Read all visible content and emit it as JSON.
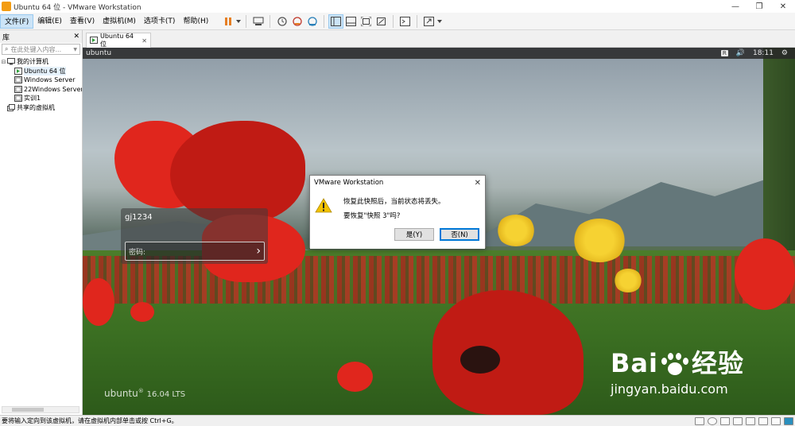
{
  "window": {
    "title": "Ubuntu 64 位 - VMware Workstation",
    "controls": {
      "minimize": "—",
      "restore": "❐",
      "close": "✕"
    }
  },
  "menubar": {
    "items": [
      "文件(F)",
      "编辑(E)",
      "查看(V)",
      "虚拟机(M)",
      "选项卡(T)",
      "帮助(H)"
    ]
  },
  "toolbar": {
    "icons": [
      "pause-icon",
      "send-ctrl-alt-del-icon",
      "snapshot-icon",
      "revert-snapshot-icon",
      "snapshot-manager-icon",
      "show-library-icon",
      "thumbnail-bar-icon",
      "fullscreen-icon",
      "unity-icon",
      "console-icon",
      "stretch-icon"
    ]
  },
  "library": {
    "title": "库",
    "close": "✕",
    "search_placeholder": "在此处键入内容...",
    "tree": [
      {
        "label": "我的计算机",
        "level": 0,
        "icon": "computer-icon",
        "expander": "⊟"
      },
      {
        "label": "Ubuntu 64 位",
        "level": 1,
        "icon": "vm-running-icon",
        "selected": true
      },
      {
        "label": "Windows Server",
        "level": 1,
        "icon": "vm-icon"
      },
      {
        "label": "22Windows Server",
        "level": 1,
        "icon": "vm-icon"
      },
      {
        "label": "实训1",
        "level": 1,
        "icon": "vm-icon"
      },
      {
        "label": "共享的虚拟机",
        "level": 0,
        "icon": "shared-vm-icon"
      }
    ]
  },
  "tabs": [
    {
      "label": "Ubuntu 64 位",
      "close": "✕"
    }
  ],
  "guest": {
    "topbar": {
      "hostname": "ubuntu",
      "keyboard": "R",
      "volume": "🔊",
      "time": "18:11",
      "settings": "⚙"
    },
    "login": {
      "username": "gj1234",
      "password_placeholder": "密码:",
      "submit_arrow": "›"
    },
    "branding": {
      "name": "ubuntu",
      "mark": "®",
      "version": "16.04 LTS"
    }
  },
  "dialog": {
    "title": "VMware Workstation",
    "close": "✕",
    "message_line1": "恢复此快照后，当前状态将丢失。",
    "message_line2": "要恢复\"快照 3\"吗?",
    "yes_label": "是(Y)",
    "no_label": "否(N)"
  },
  "watermark": {
    "brand_left": "Bai",
    "brand_right": "经验",
    "url": "jingyan.baidu.com"
  },
  "statusbar": {
    "message": "要将输入定向到该虚拟机，请在虚拟机内部单击或按 Ctrl+G。",
    "device_icons": [
      "hdd-icon",
      "cd-icon",
      "network-icon",
      "usb-icon",
      "printer-icon",
      "sound-icon",
      "display-icon",
      "message-icon"
    ]
  },
  "colors": {
    "accent": "#0078d7",
    "pause_orange": "#e67e22",
    "poppy_red": "#e0261d"
  }
}
